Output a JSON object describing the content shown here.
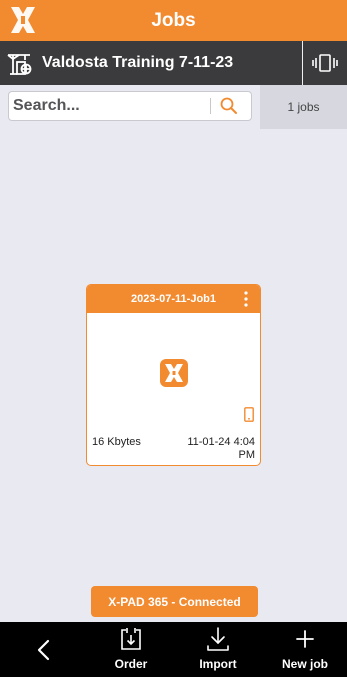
{
  "header": {
    "title": "Jobs",
    "logo_icon": "x-pad-logo-icon"
  },
  "project": {
    "title": "Valdosta Training 7-11-23",
    "site_icon": "construction-site-icon",
    "device_icon": "device-switch-icon"
  },
  "search": {
    "placeholder": "Search...",
    "jobs_count": "1 jobs"
  },
  "jobs": [
    {
      "name": "2023-07-11-Job1",
      "size": "16 Kbytes",
      "date": "11-01-24 4:04 PM"
    }
  ],
  "status": {
    "message": "X-PAD 365 - Connected"
  },
  "bottom_nav": {
    "order_label": "Order",
    "import_label": "Import",
    "new_job_label": "New job"
  },
  "colors": {
    "accent": "#f28a30",
    "dark_bar": "#3b3b3d",
    "background": "#e9eaf1"
  }
}
